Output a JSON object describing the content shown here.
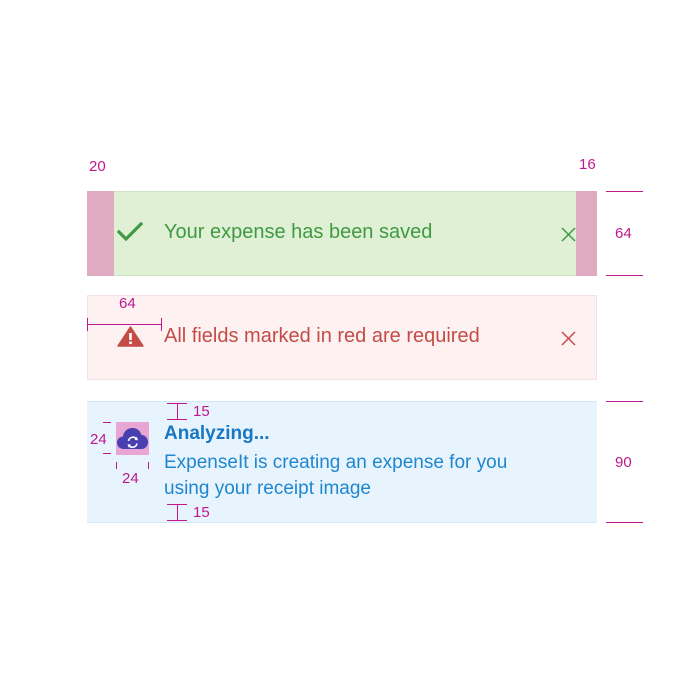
{
  "dimensions": {
    "left_padding": "20",
    "right_padding": "16",
    "success_height": "64",
    "icon_column_width": "64",
    "top_spacing": "15",
    "bottom_spacing": "15",
    "icon_height": "24",
    "icon_width": "24",
    "info_height": "90"
  },
  "success_banner": {
    "message": "Your expense has been saved",
    "icon": "checkmark-icon",
    "close_icon": "close-icon",
    "color": "#3f9a44"
  },
  "error_banner": {
    "message": "All fields marked in red are required",
    "icon": "warning-icon",
    "close_icon": "close-icon",
    "color": "#c44c47"
  },
  "info_banner": {
    "title": "Analyzing...",
    "body": "ExpenseIt is creating an expense for you using your receipt image",
    "icon": "cloud-sync-icon",
    "color": "#1777c4"
  },
  "colors": {
    "annotation": "#c0178f",
    "padding_highlight": "#e0aac1",
    "success_bg": "#dff0d5",
    "error_bg": "#fdf1f1",
    "info_bg": "#e8f4fd"
  }
}
